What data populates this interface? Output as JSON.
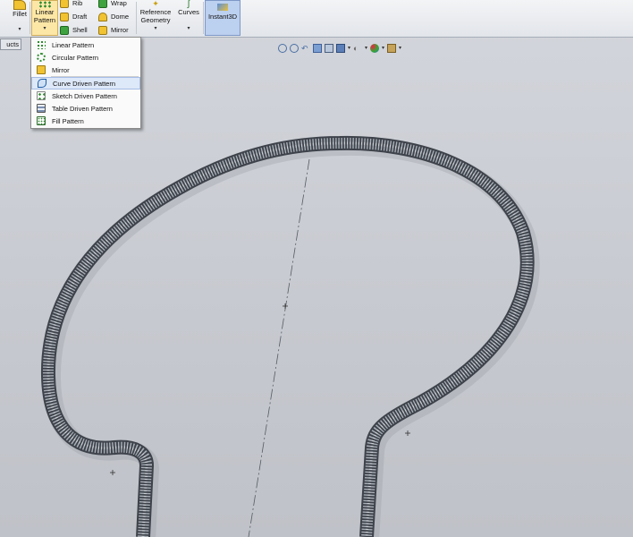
{
  "ribbon": {
    "fillet": "Fillet",
    "linear_pattern": "Linear Pattern",
    "rib": "Rib",
    "draft": "Draft",
    "shell": "Shell",
    "wrap": "Wrap",
    "dome": "Dome",
    "mirror": "Mirror",
    "reference_geometry": "Reference Geometry",
    "curves": "Curves",
    "instant3d": "Instant3D"
  },
  "tabs": {
    "products": "ucts"
  },
  "pattern_menu": {
    "items": [
      {
        "label": "Linear Pattern",
        "icon": "linear-pattern-icon"
      },
      {
        "label": "Circular Pattern",
        "icon": "circular-pattern-icon"
      },
      {
        "label": "Mirror",
        "icon": "mirror-icon"
      },
      {
        "label": "Curve Driven Pattern",
        "icon": "curve-driven-pattern-icon",
        "highlighted": true
      },
      {
        "label": "Sketch Driven Pattern",
        "icon": "sketch-driven-pattern-icon"
      },
      {
        "label": "Table Driven Pattern",
        "icon": "table-driven-pattern-icon"
      },
      {
        "label": "Fill Pattern",
        "icon": "fill-pattern-icon"
      }
    ]
  },
  "heads_up_toolbar": [
    "zoom-to-fit-icon",
    "zoom-to-area-icon",
    "previous-view-icon",
    "section-view-icon",
    "view-orientation-icon",
    "display-style-icon",
    "hide-show-icon",
    "edit-appearance-icon",
    "apply-scene-icon"
  ],
  "colors": {
    "highlight": "#dde8f8",
    "active_button": "#fde7a7",
    "instant3d": "#bcd0ef"
  }
}
